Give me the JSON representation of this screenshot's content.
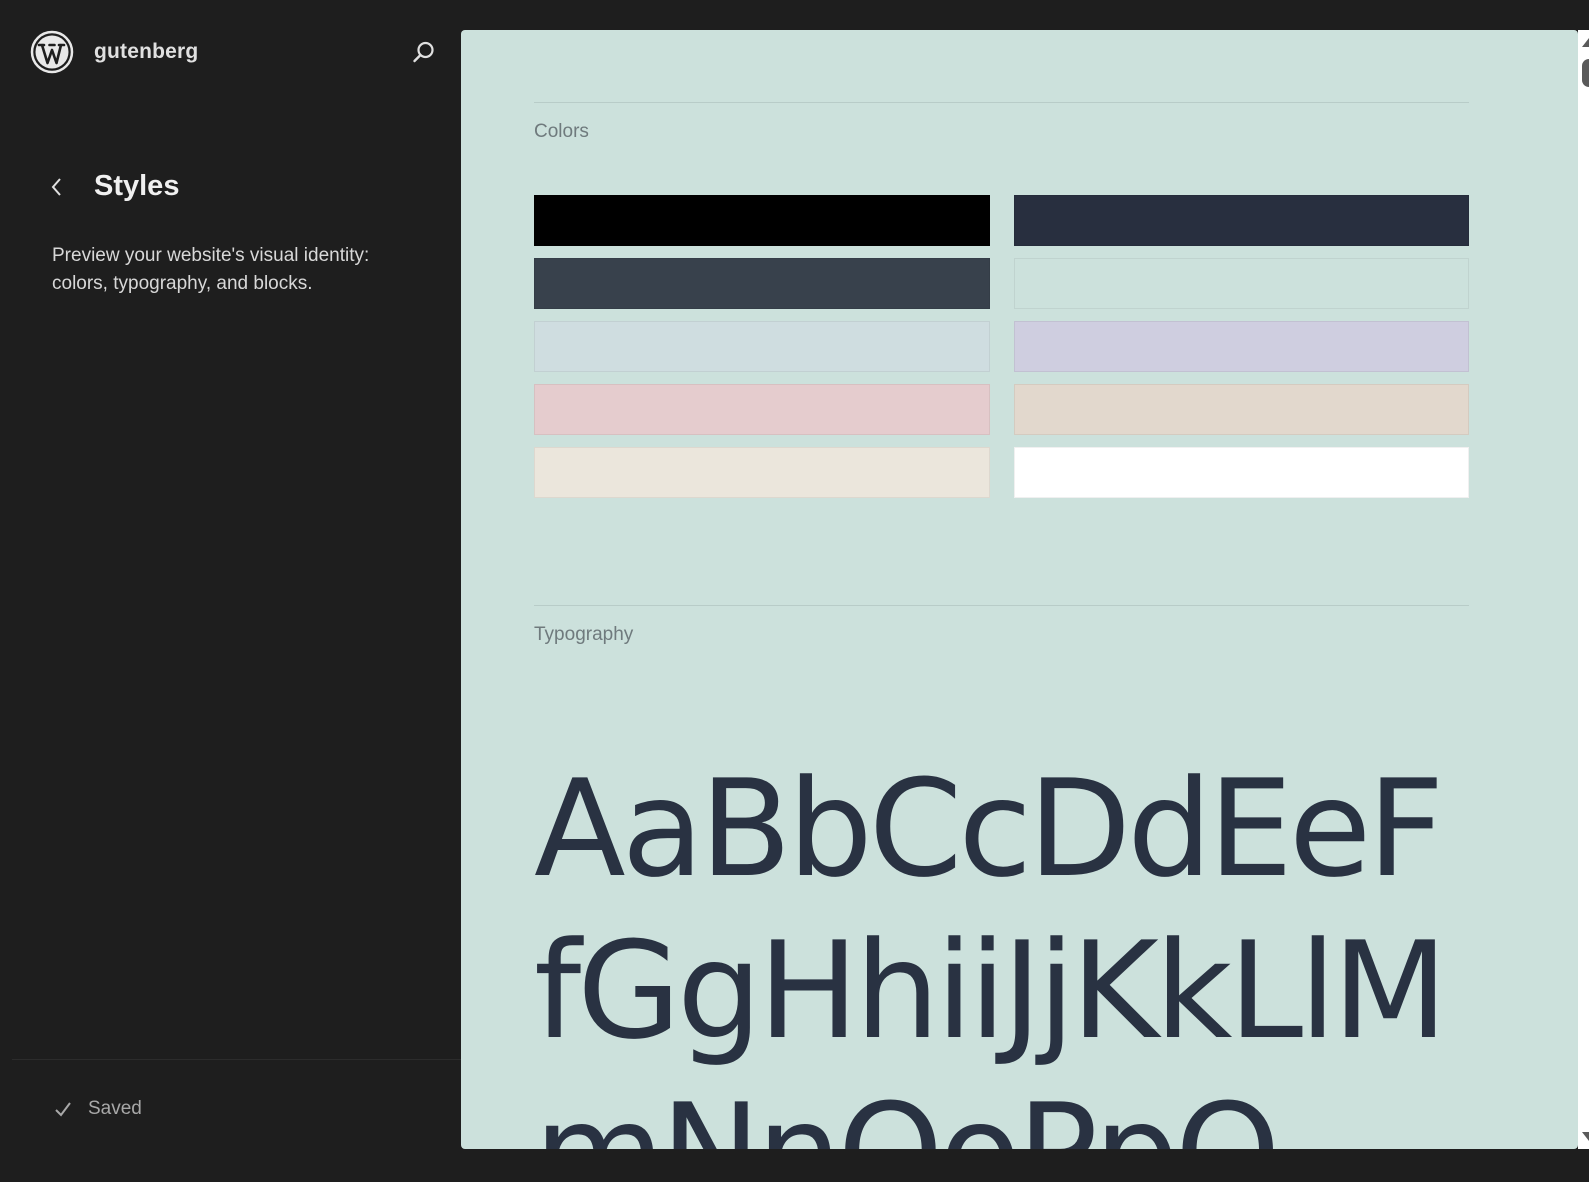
{
  "header": {
    "site_name": "gutenberg",
    "logo_icon": "wordpress-logo-icon",
    "search_icon": "search-icon"
  },
  "navigation": {
    "back_icon": "chevron-left-icon",
    "title": "Styles",
    "description": "Preview your website's visual identity: colors, typography, and blocks."
  },
  "footer": {
    "status_icon": "check-icon",
    "status_text": "Saved"
  },
  "preview": {
    "background": "#cce1dc",
    "colors_label": "Colors",
    "palette": [
      "#000000",
      "#282f3f",
      "#38414c",
      "#cce1dc",
      "#cfdde0",
      "#cfcee0",
      "#e5ccce",
      "#e2d8cd",
      "#ebe6dc",
      "#ffffff"
    ],
    "typography_label": "Typography",
    "typography_sample": "AaBbCcDdEeFfGgHhiiJjKkLlMmNnOoPpQ",
    "text_color": "#293242"
  }
}
